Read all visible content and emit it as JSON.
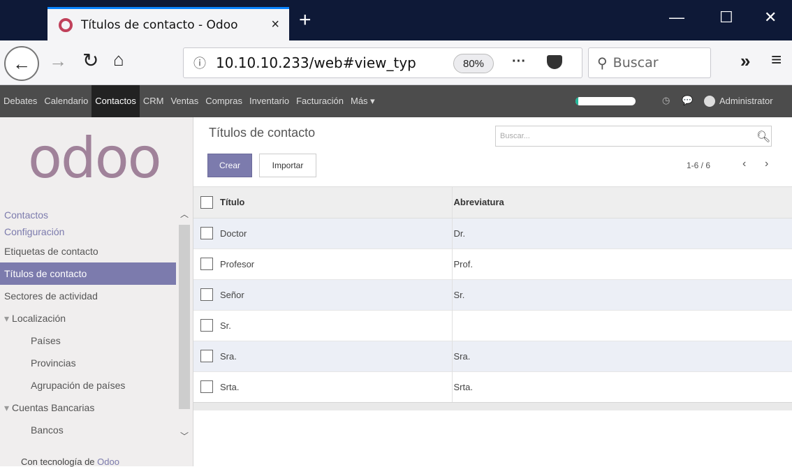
{
  "browser": {
    "tab_title": "Títulos de contacto - Odoo",
    "tab_close": "×",
    "new_tab": "+",
    "url": "10.10.10.233/web#view_typ",
    "zoom": "80%",
    "search_placeholder": "Buscar"
  },
  "topmenu": {
    "items": [
      "Debates",
      "Calendario",
      "Contactos",
      "CRM",
      "Ventas",
      "Compras",
      "Inventario",
      "Facturación",
      "Más ▾"
    ],
    "active_index": 2,
    "progress": 0.05,
    "user": "Administrator"
  },
  "sidebar": {
    "logo": "odoo",
    "section_contacts": "Contactos",
    "section_config": "Configuración",
    "items": [
      {
        "label": "Etiquetas de contacto",
        "level": 1
      },
      {
        "label": "Títulos de contacto",
        "level": 1,
        "active": true
      },
      {
        "label": "Sectores de actividad",
        "level": 1
      },
      {
        "label": "Localización",
        "level": 1,
        "group": true
      },
      {
        "label": "Países",
        "level": 2
      },
      {
        "label": "Provincias",
        "level": 2
      },
      {
        "label": "Agrupación de países",
        "level": 2
      },
      {
        "label": "Cuentas Bancarias",
        "level": 1,
        "group": true
      },
      {
        "label": "Bancos",
        "level": 2
      }
    ],
    "powered_prefix": "Con tecnología de",
    "powered_brand": "Odoo"
  },
  "main": {
    "title": "Títulos de contacto",
    "create_label": "Crear",
    "import_label": "Importar",
    "search_placeholder": "Buscar...",
    "pager": "1-6 / 6",
    "columns": [
      "Título",
      "Abreviatura"
    ],
    "rows": [
      {
        "title": "Doctor",
        "abbr": "Dr."
      },
      {
        "title": "Profesor",
        "abbr": "Prof."
      },
      {
        "title": "Señor",
        "abbr": "Sr."
      },
      {
        "title": "Sr.",
        "abbr": ""
      },
      {
        "title": "Sra.",
        "abbr": "Sra."
      },
      {
        "title": "Srta.",
        "abbr": "Srta."
      }
    ]
  }
}
